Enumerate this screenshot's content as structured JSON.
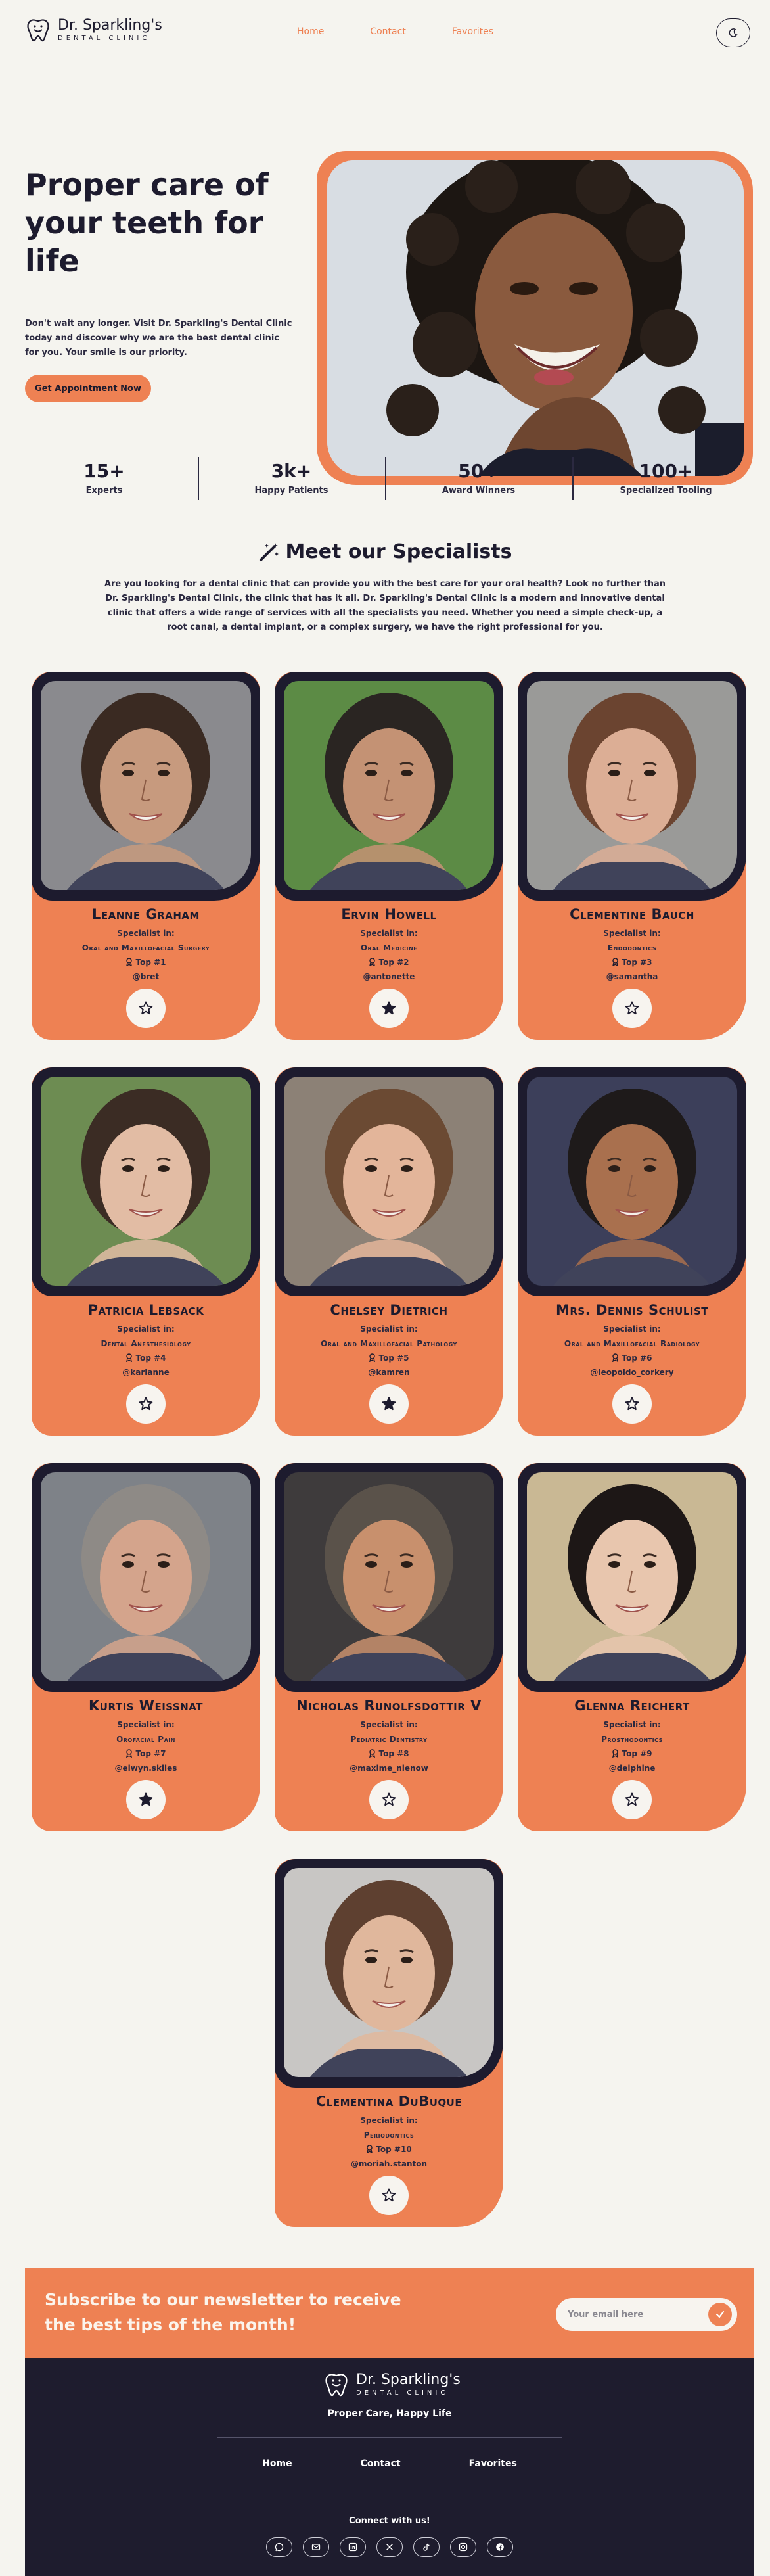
{
  "brand": {
    "name": "Dr. Sparkling's",
    "sub": "DENTAL CLINIC"
  },
  "nav": [
    "Home",
    "Contact",
    "Favorites"
  ],
  "hero": {
    "title": "Proper care of your teeth for life",
    "text": "Don't wait any longer. Visit Dr. Sparkling's Dental Clinic today and discover why we are the best dental clinic for you. Your smile is our priority.",
    "cta": "Get Appointment Now"
  },
  "stats": [
    {
      "value": "15+",
      "label": "Experts"
    },
    {
      "value": "3k+",
      "label": "Happy Patients"
    },
    {
      "value": "50+",
      "label": "Award Winners"
    },
    {
      "value": "100+",
      "label": "Specialized Tooling"
    }
  ],
  "specialists": {
    "title": "Meet our Specialists",
    "intro": "Are you looking for a dental clinic that can provide you with the best care for your oral health? Look no further than Dr. Sparkling's Dental Clinic, the clinic that has it all. Dr. Sparkling's Dental Clinic is a modern and innovative dental clinic that offers a wide range of services with all the specialists you need. Whether you need a simple check-up, a root canal, a dental implant, or a complex surgery, we have the right professional for you.",
    "specialist_label": "Specialist in:",
    "doctors": [
      {
        "name": "Leanne Graham",
        "field": "Oral and Maxillofacial Surgery",
        "top": "Top #1",
        "user": "@bret",
        "favorite": false,
        "skin": "#c79a7e",
        "hair": "#3a2a22",
        "bg": "#8a8a8e"
      },
      {
        "name": "Ervin Howell",
        "field": "Oral Medicine",
        "top": "Top #2",
        "user": "@antonette",
        "favorite": true,
        "skin": "#c49274",
        "hair": "#2a2522",
        "bg": "#5c8b45"
      },
      {
        "name": "Clementine Bauch",
        "field": "Endodontics",
        "top": "Top #3",
        "user": "@samantha",
        "favorite": false,
        "skin": "#dcae95",
        "hair": "#6b4430",
        "bg": "#9a9a98"
      },
      {
        "name": "Patricia Lebsack",
        "field": "Dental Anesthesiology",
        "top": "Top #4",
        "user": "@karianne",
        "favorite": false,
        "skin": "#e2bca4",
        "hair": "#3b2c24",
        "bg": "#6d8c52"
      },
      {
        "name": "Chelsey Dietrich",
        "field": "Oral and Maxillofacial Pathology",
        "top": "Top #5",
        "user": "@kamren",
        "favorite": true,
        "skin": "#e3b59a",
        "hair": "#6b4a33",
        "bg": "#8c8176"
      },
      {
        "name": "Mrs. Dennis Schulist",
        "field": "Oral and Maxillofacial Radiology",
        "top": "Top #6",
        "user": "@leopoldo_corkery",
        "favorite": false,
        "skin": "#a9704e",
        "hair": "#1e1a1a",
        "bg": "#3c3f5a"
      },
      {
        "name": "Kurtis Weissnat",
        "field": "Orofacial Pain",
        "top": "Top #7",
        "user": "@elwyn.skiles",
        "favorite": true,
        "skin": "#d4a48c",
        "hair": "#8e8a86",
        "bg": "#7e8288"
      },
      {
        "name": "Nicholas Runolfsdottir V",
        "field": "Pediatric Dentistry",
        "top": "Top #8",
        "user": "@maxime_nienow",
        "favorite": false,
        "skin": "#c8906d",
        "hair": "#5a524a",
        "bg": "#3e3b3c"
      },
      {
        "name": "Glenna Reichert",
        "field": "Prosthodontics",
        "top": "Top #9",
        "user": "@delphine",
        "favorite": false,
        "skin": "#e8c6ae",
        "hair": "#1d1716",
        "bg": "#c9b894"
      },
      {
        "name": "Clementina DuBuque",
        "field": "Periodontics",
        "top": "Top #10",
        "user": "@moriah.stanton",
        "favorite": false,
        "skin": "#e0b79c",
        "hair": "#5e4030",
        "bg": "#c8c6c4"
      }
    ]
  },
  "newsletter": {
    "text": "Subscribe to our newsletter to receive the best tips of the month!",
    "placeholder": "Your email here"
  },
  "footer": {
    "tagline": "Proper Care, Happy Life",
    "nav": [
      "Home",
      "Contact",
      "Favorites"
    ],
    "connect": "Connect with us!",
    "socials": [
      "whatsapp-icon",
      "mail-icon",
      "linkedin-icon",
      "x-icon",
      "tiktok-icon",
      "instagram-icon",
      "facebook-icon"
    ]
  },
  "colors": {
    "accent": "#ee8153",
    "dark": "#1e1c2e",
    "background": "#f5f4ef"
  }
}
